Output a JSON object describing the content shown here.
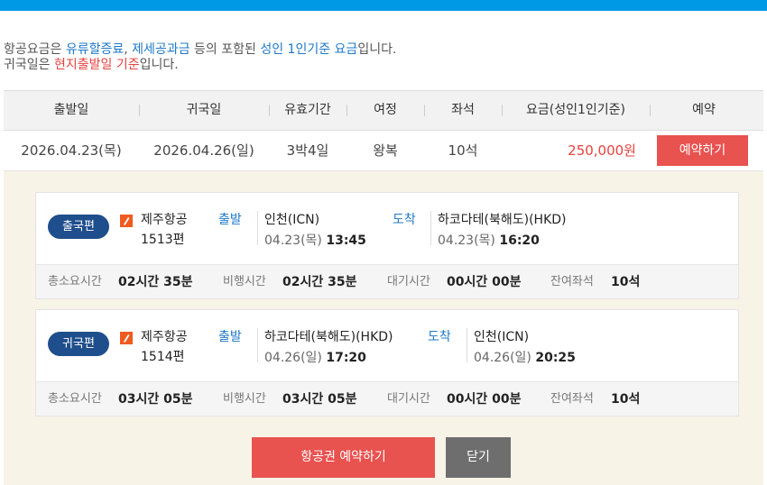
{
  "colors": {
    "top_bar": "#0099e6",
    "accent_blue": "#1e78c8",
    "accent_red": "#e8423f",
    "pill": "#1f4e8c"
  },
  "notice": {
    "line1_prefix": "항공요금은 ",
    "line1_hl1": "유류할증료",
    "line1_comma": ", ",
    "line1_hl2": "제세공과금",
    "line1_mid": " 등의 포함된 ",
    "line1_hl3": "성인 1인기준 요금",
    "line1_suffix": "입니다.",
    "line2_prefix": "귀국일은 ",
    "line2_hl": "현지출발일 기준",
    "line2_suffix": "입니다."
  },
  "table": {
    "headers": [
      "출발일",
      "귀국일",
      "유효기간",
      "여정",
      "좌석",
      "요금(성인1인기준)",
      "예약"
    ],
    "row": {
      "depart": "2026.04.23(목)",
      "return": "2026.04.26(일)",
      "validity": "3박4일",
      "trip": "왕복",
      "seats": "10석",
      "price": "250,000원",
      "reserve_label": "예약하기"
    }
  },
  "outbound": {
    "badge": "출국편",
    "airline_icon": "jejuair-logo-icon",
    "airline": "제주항공",
    "flight_no": "1513편",
    "depart_label": "출발",
    "depart_city": "인천(ICN)",
    "depart_date": "04.23(목)",
    "depart_time": "13:45",
    "arrive_label": "도착",
    "arrive_city": "하코다테(북해도)(HKD)",
    "arrive_date": "04.23(목)",
    "arrive_time": "16:20",
    "total_label": "총소요시간",
    "total_value": "02시간 35분",
    "flight_label": "비행시간",
    "flight_value": "02시간 35분",
    "wait_label": "대기시간",
    "wait_value": "00시간 00분",
    "seats_label": "잔여좌석",
    "seats_value": "10석"
  },
  "inbound": {
    "badge": "귀국편",
    "airline_icon": "jejuair-logo-icon",
    "airline": "제주항공",
    "flight_no": "1514편",
    "depart_label": "출발",
    "depart_city": "하코다테(북해도)(HKD)",
    "depart_date": "04.26(일)",
    "depart_time": "17:20",
    "arrive_label": "도착",
    "arrive_city": "인천(ICN)",
    "arrive_date": "04.26(일)",
    "arrive_time": "20:25",
    "total_label": "총소요시간",
    "total_value": "03시간 05분",
    "flight_label": "비행시간",
    "flight_value": "03시간 05분",
    "wait_label": "대기시간",
    "wait_value": "00시간 00분",
    "seats_label": "잔여좌석",
    "seats_value": "10석"
  },
  "actions": {
    "book_label": "항공권 예약하기",
    "close_label": "닫기"
  }
}
